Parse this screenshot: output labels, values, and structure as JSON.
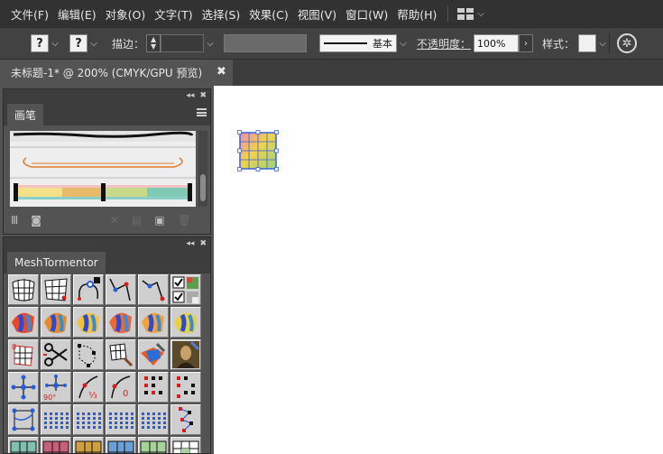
{
  "menubar": {
    "items": [
      "文件(F)",
      "编辑(E)",
      "对象(O)",
      "文字(T)",
      "选择(S)",
      "效果(C)",
      "视图(V)",
      "窗口(W)",
      "帮助(H)"
    ],
    "workspace_icon": "workspace-grid-icon"
  },
  "controlbar": {
    "fill_swatch": "?",
    "stroke_swatch": "?",
    "stroke_label": "描边：",
    "brush_label": "基本",
    "opacity_label": "不透明度：",
    "opacity_value": "100%",
    "style_label": "样式："
  },
  "document": {
    "tab_title": "未标题-1* @ 200% (CMYK/GPU 预览)",
    "close_glyph": "✖"
  },
  "brushes_panel": {
    "title": "画笔",
    "collapse_glyph": "◂◂",
    "close_glyph": "✖"
  },
  "mesh_panel": {
    "title": "MeshTormentor",
    "collapse_glyph": "◂◂",
    "close_glyph": "✖",
    "tool_rows": [
      [
        "warp-mesh-tool",
        "distort-mesh-tool",
        "add-point-tool",
        "node-path-tool",
        "node-path-tool-2",
        "checkbox-options"
      ],
      [
        "gradient-mesh-1",
        "gradient-mesh-2",
        "gradient-mesh-3",
        "gradient-mesh-4",
        "gradient-mesh-5",
        "gradient-mesh-6"
      ],
      [
        "rotate-mesh-tool",
        "scissors-tool",
        "knife-path-tool",
        "brush-mesh-tool",
        "paint-mesh-tool",
        "mona-lisa-image-tool"
      ],
      [
        "spread-points-tool",
        "rotate-points-90-tool",
        "divide-one-third-tool",
        "curve-zero-tool",
        "points-pattern-tool",
        "points-pattern-tool-2"
      ],
      [
        "select-path-tool",
        "dot-grid-tool",
        "dot-grid-tool-2",
        "dot-grid-tool-3",
        "dot-grid-tool-4",
        "dot-path-tool"
      ],
      [
        "color-mesh-tool",
        "color-mesh-tool-2",
        "color-mesh-tool-3",
        "color-mesh-tool-4",
        "color-mesh-tool-5",
        "grid-table-tool"
      ]
    ]
  },
  "colors": {
    "menubar_bg": "#323232",
    "panel_bg": "#535353",
    "canvas_bg": "#ffffff",
    "accent_red": "#d22020",
    "accent_blue": "#2a5bd7"
  }
}
